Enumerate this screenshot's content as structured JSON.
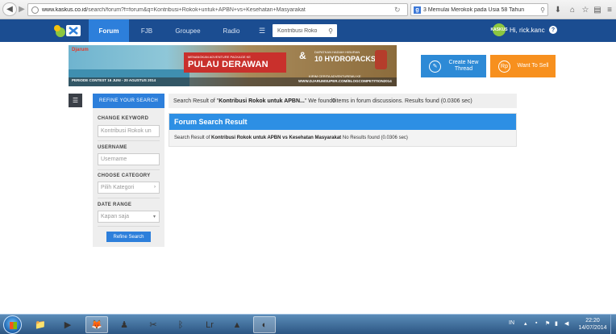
{
  "browser": {
    "back_glyph": "◀",
    "fwd_glyph": "▶",
    "url_host": "www.kaskus.co.id",
    "url_path": "/search/forum?f=forum&q=Kontribusi+Rokok+untuk+APBN+vs+Kesehatan+Masyarakat",
    "search_text": "3 Memulai Merokok pada Usia 58 Tahun",
    "reload_glyph": "↻",
    "icons": [
      "download-icon",
      "home-icon",
      "bookmark-star-icon",
      "clipboard-icon",
      "menu-icon"
    ]
  },
  "site": {
    "nav_tabs": [
      "Forum",
      "FJB",
      "Groupee",
      "Radio"
    ],
    "search_value": "Kontribusi Roko",
    "user_greeting": "Hi, rick.kanc",
    "avatar_text": "KASKUS"
  },
  "banner": {
    "brand": "Djarum",
    "sub_text": "MENANGKAN ADVENTURE PACKAGE KE",
    "main_text": "PULAU DERAWAN",
    "prize_sub": "DAPATKAN HADIAH HIBURAN",
    "prize_main": "10 HYDROPACKS",
    "kirim_text": "KIRIM CERITA ADVENTUREMU KE",
    "url_text": "WWW.DJARUMSUPER.COM/BLOGCOMPETITION2014",
    "period_text": "PERIODE CONTEST 16 JUNI - 20 AGUSTUS 2014"
  },
  "actions": {
    "create_label": "Create New Thread",
    "sell_label": "Want To Sell",
    "sell_icon_text": "Rp"
  },
  "sidebar": {
    "refine_tab_label": "REFINE YOUR SEARCH",
    "change_keyword_label": "CHANGE KEYWORD",
    "keyword_value": "Kontribusi Rokok un",
    "username_label": "USERNAME",
    "username_placeholder": "Username",
    "category_label": "CHOOSE CATEGORY",
    "category_value": "Pilih Kategori",
    "date_label": "DATE RANGE",
    "date_value": "Kapan saja",
    "refine_button": "Refine Search"
  },
  "results": {
    "line_prefix": "Search Result of \"",
    "line_query": "Kontribusi Rokok untuk APBN...",
    "line_mid": "\" We found ",
    "line_count": "0",
    "line_suffix": " items in forum discussions. Results found (0.0306 sec)",
    "panel_title": "Forum Search Result",
    "body_prefix": "Search Result of ",
    "body_query": "Kontribusi Rokok untuk APBN vs Kesehatan Masyarakat",
    "body_suffix": " No Results found (0.0306 sec)"
  },
  "taskbar": {
    "lang": "IN",
    "time": "22:20",
    "date": "14/07/2014",
    "lr_text": "Lr"
  },
  "colors": {
    "site_header": "#1b4d91",
    "active_tab": "#2d7fdb",
    "create_button": "#2d8ad6",
    "sell_button": "#f7901e"
  }
}
